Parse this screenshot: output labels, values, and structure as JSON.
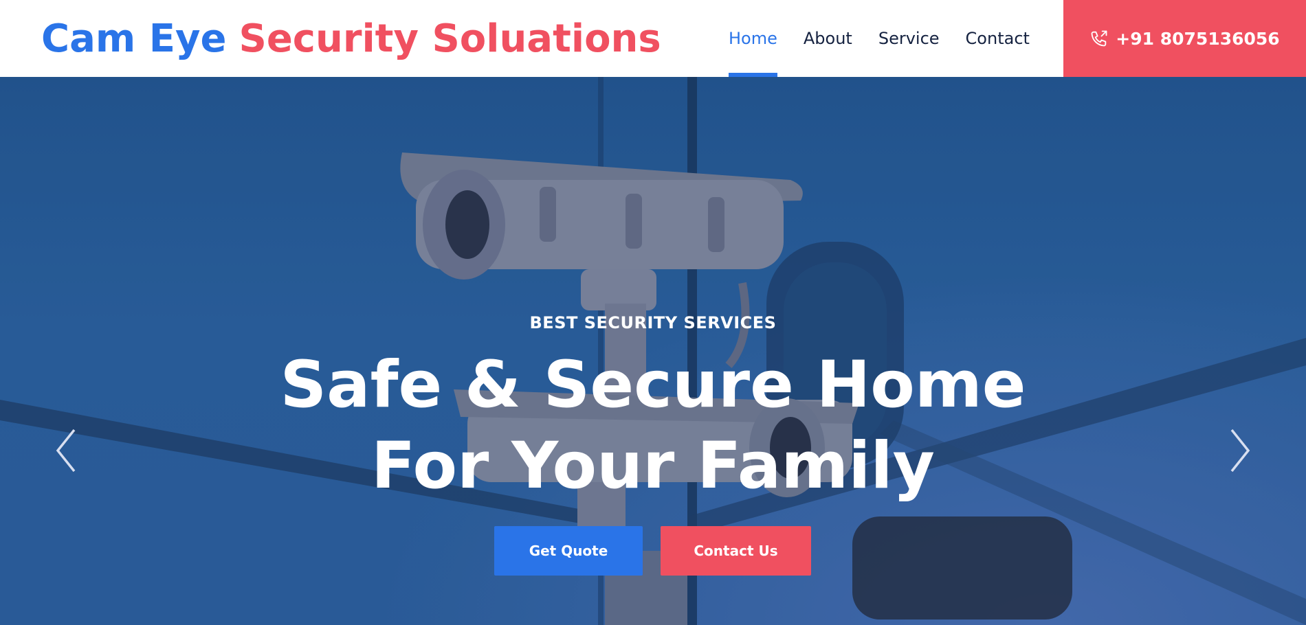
{
  "brand": {
    "part1": "Cam Eye",
    "part2": "Security Soluations",
    "color_primary": "#2a74e8",
    "color_accent": "#f05060"
  },
  "nav": {
    "items": [
      {
        "label": "Home",
        "active": true
      },
      {
        "label": "About",
        "active": false
      },
      {
        "label": "Service",
        "active": false
      },
      {
        "label": "Contact",
        "active": false
      }
    ]
  },
  "phone": {
    "icon": "phone-outgoing-icon",
    "number": "+91 8075136056"
  },
  "hero": {
    "eyebrow": "BEST SECURITY SERVICES",
    "headline_line1": "Safe & Secure Home",
    "headline_line2": "For Your Family",
    "buttons": {
      "quote": "Get Quote",
      "contact": "Contact Us"
    },
    "carousel": {
      "prev_icon": "chevron-left-icon",
      "next_icon": "chevron-right-icon"
    }
  }
}
